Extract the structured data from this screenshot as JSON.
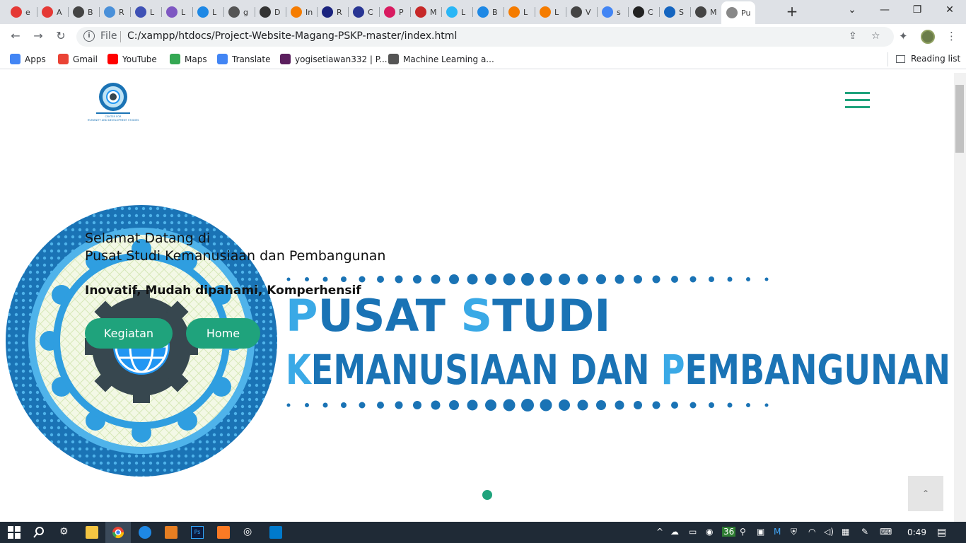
{
  "tabs": [
    {
      "title": "e",
      "icon": "red-circle-icon",
      "color": "#e53935"
    },
    {
      "title": "A",
      "icon": "red-pen-icon",
      "color": "#e53935"
    },
    {
      "title": "B",
      "icon": "globe-icon",
      "color": "#444444"
    },
    {
      "title": "R",
      "icon": "blue-chat-icon",
      "color": "#4a90d9"
    },
    {
      "title": "L",
      "icon": "blue-b-icon",
      "color": "#3f51b5"
    },
    {
      "title": "L",
      "icon": "purple-m-icon",
      "color": "#7e57c2"
    },
    {
      "title": "L",
      "icon": "blue-globe-icon",
      "color": "#1e88e5"
    },
    {
      "title": "g",
      "icon": "star-icon",
      "color": "#555555"
    },
    {
      "title": "D",
      "icon": "dark-square-icon",
      "color": "#333333"
    },
    {
      "title": "In",
      "icon": "orange-j-icon",
      "color": "#f57c00"
    },
    {
      "title": "R",
      "icon": "navy-j-icon",
      "color": "#1a237e"
    },
    {
      "title": "C",
      "icon": "navy-circle-icon",
      "color": "#283593"
    },
    {
      "title": "P",
      "icon": "pink-code-icon",
      "color": "#d81b60"
    },
    {
      "title": "M",
      "icon": "red-du-icon",
      "color": "#c62828"
    },
    {
      "title": "L",
      "icon": "blue-bird-icon",
      "color": "#29b6f6"
    },
    {
      "title": "B",
      "icon": "blue-c-icon",
      "color": "#1e88e5"
    },
    {
      "title": "L",
      "icon": "orange-j-icon",
      "color": "#f57c00"
    },
    {
      "title": "L",
      "icon": "orange-j-icon",
      "color": "#f57c00"
    },
    {
      "title": "V",
      "icon": "globe-icon",
      "color": "#444444"
    },
    {
      "title": "s",
      "icon": "google-g-icon",
      "color": "#4285f4"
    },
    {
      "title": "C",
      "icon": "github-icon",
      "color": "#222222"
    },
    {
      "title": "S",
      "icon": "blue-stack-icon",
      "color": "#1565c0"
    },
    {
      "title": "M",
      "icon": "globe-icon",
      "color": "#444444"
    },
    {
      "title": "Pu",
      "icon": "page-icon",
      "color": "#888888",
      "active": true
    }
  ],
  "toolbar": {
    "file_label": "File",
    "url": "C:/xampp/htdocs/Project-Website-Magang-PSKP-master/index.html"
  },
  "bookmarks": [
    {
      "label": "Apps",
      "icon": "apps-grid-icon",
      "color": "#4285f4"
    },
    {
      "label": "Gmail",
      "icon": "gmail-icon",
      "color": "#ea4335"
    },
    {
      "label": "YouTube",
      "icon": "youtube-icon",
      "color": "#ff0000"
    },
    {
      "label": "Maps",
      "icon": "maps-pin-icon",
      "color": "#34a853"
    },
    {
      "label": "Translate",
      "icon": "translate-icon",
      "color": "#4285f4"
    },
    {
      "label": "yogisetiawan332 | P...",
      "icon": "purple-p-icon",
      "color": "#5b1f5e"
    },
    {
      "label": "Machine Learning a...",
      "icon": "globe-icon",
      "color": "#555555"
    }
  ],
  "reading_list": "Reading list",
  "hero": {
    "line1": "Selamat Datang di",
    "line2": "Pusat Studi Kemanusiaan dan Pembangunan",
    "tagline": "Inovatif, Mudah dipahami, Komperhensif",
    "btn_kegiatan": "Kegiatan",
    "btn_home": "Home"
  },
  "banner": {
    "line1_a": "P",
    "line1_b": "USAT ",
    "line1_c": "S",
    "line1_d": "TUDI",
    "line2_a": "K",
    "line2_b": "EMANUSIAAN DAN ",
    "line2_c": "P",
    "line2_d": "EMBANGUNAN"
  },
  "logo_text": "CENTER FOR HUMANITY AND DEVELOPMENT STUDIES",
  "to_top_icon": "chevron-up-icon",
  "taskbar": {
    "clock": "0:49",
    "tray_number": "36"
  },
  "colors": {
    "accent": "#1fa37c",
    "banner_dark": "#1a73b5",
    "banner_light": "#3aa9e6"
  }
}
